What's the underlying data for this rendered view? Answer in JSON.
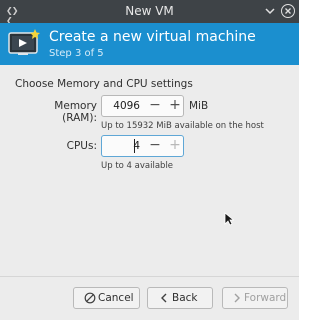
{
  "window": {
    "title": "New VM",
    "app_icon": "wm-menu-icon",
    "controls": [
      "minimize-icon",
      "close-icon"
    ]
  },
  "banner": {
    "heading": "Create a new virtual machine",
    "step": "Step 3 of 5",
    "color": "#1b8fcf"
  },
  "section": {
    "label": "Choose Memory and CPU settings"
  },
  "memory": {
    "label": "Memory (RAM):",
    "value": "4096",
    "unit": "MiB",
    "hint": "Up to 15932 MiB available on the host"
  },
  "cpus": {
    "label": "CPUs:",
    "value": "4",
    "hint": "Up to 4 available"
  },
  "buttons": {
    "cancel": "Cancel",
    "back": "Back",
    "forward": "Forward"
  }
}
